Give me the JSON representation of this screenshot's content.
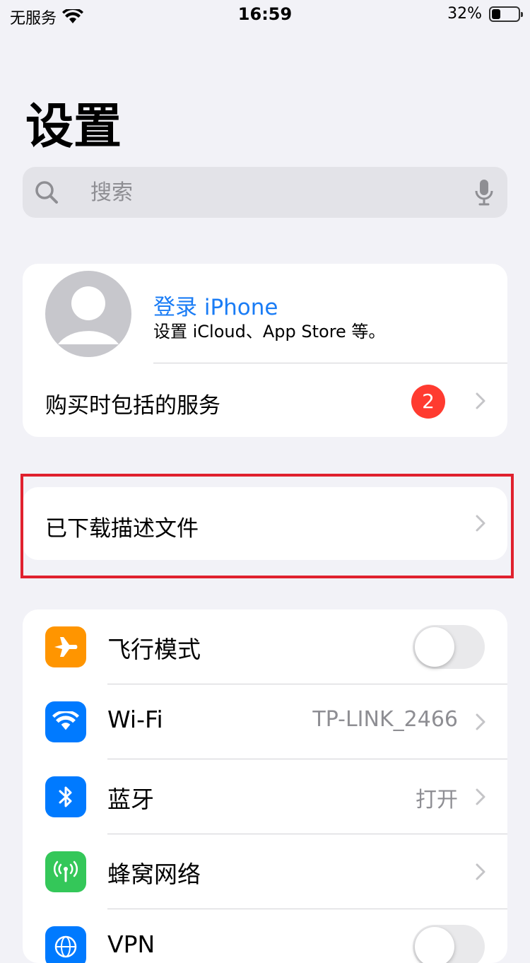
{
  "status_bar": {
    "carrier": "无服务",
    "time": "16:59",
    "battery_text": "32%",
    "battery_level": 0.32
  },
  "page_title": "设置",
  "search": {
    "placeholder": "搜索"
  },
  "profile": {
    "title": "登录 iPhone",
    "subtitle": "设置 iCloud、App Store 等。",
    "services_label": "购买时包括的服务",
    "services_badge": "2"
  },
  "profiles_row": {
    "label": "已下载描述文件"
  },
  "settings": {
    "airplane": {
      "label": "飞行模式",
      "on": false,
      "icon": "airplane-icon",
      "color": "#ff9500"
    },
    "wifi": {
      "label": "Wi-Fi",
      "value": "TP-LINK_2466",
      "icon": "wifi-icon",
      "color": "#007aff"
    },
    "bluetooth": {
      "label": "蓝牙",
      "value": "打开",
      "icon": "bluetooth-icon",
      "color": "#007aff"
    },
    "cellular": {
      "label": "蜂窝网络",
      "icon": "cellular-icon",
      "color": "#34c759"
    },
    "vpn": {
      "label": "VPN",
      "on": false,
      "icon": "vpn-icon",
      "color": "#007aff"
    }
  },
  "colors": {
    "accent": "#1a7cf5",
    "badge": "#ff3b30",
    "highlight": "#e0212e",
    "background": "#f2f2f7"
  }
}
